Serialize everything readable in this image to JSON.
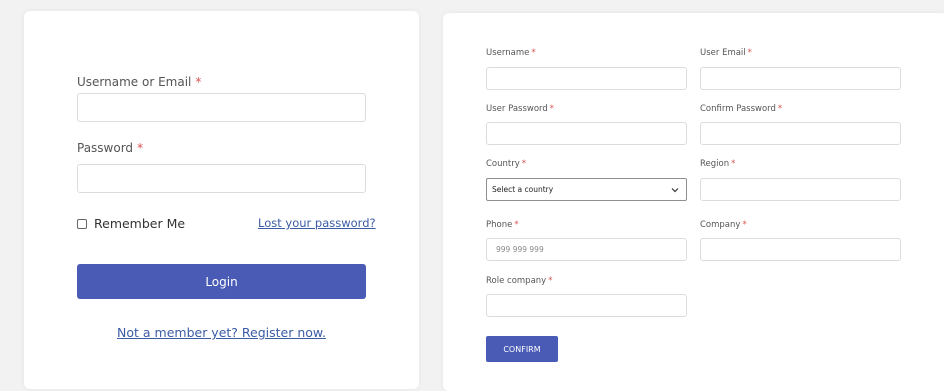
{
  "login": {
    "username_label": "Username or Email",
    "password_label": "Password",
    "required_mark": "*",
    "remember_label": "Remember Me",
    "lost_password": "Lost your password?",
    "login_button": "Login",
    "register_link": "Not a member yet? Register now."
  },
  "register": {
    "required_mark": "*",
    "username_label": "Username",
    "email_label": "User Email",
    "password_label": "User Password",
    "confirm_password_label": "Confirm Password",
    "country_label": "Country",
    "country_selected": "Select a country",
    "region_label": "Region",
    "phone_label": "Phone",
    "phone_placeholder": "999 999 999",
    "company_label": "Company",
    "role_company_label": "Role company",
    "confirm_button": "CONFIRM"
  },
  "colors": {
    "accent": "#4a5bb5",
    "required": "#d9534f",
    "link": "#3b5ba5"
  }
}
